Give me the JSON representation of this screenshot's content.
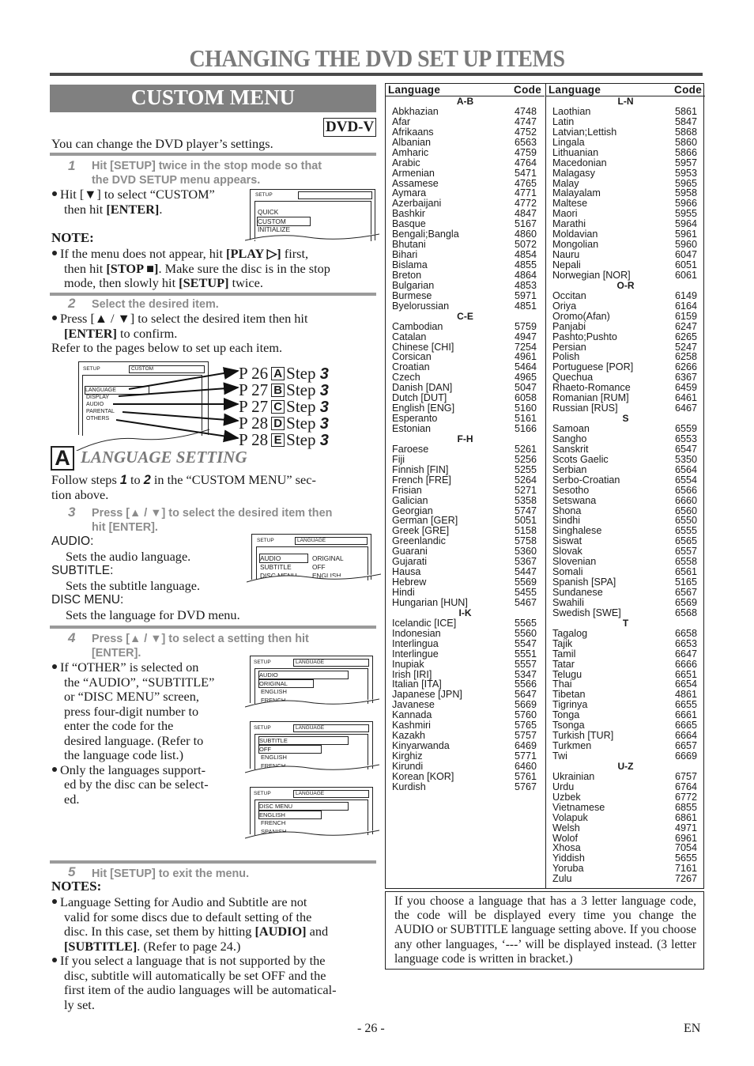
{
  "page_title": "CHANGING THE DVD SET UP ITEMS",
  "section_title": "CUSTOM MENU",
  "badge": "DVD-V",
  "intro": "You can change the DVD player’s settings.",
  "step1": {
    "num": "1",
    "line1": "Hit [SETUP] twice in the stop mode so that",
    "line2": "the DVD SETUP menu appears.",
    "bullet_line1": "Hit [▼] to select “CUSTOM”",
    "bullet_line2_pre": "then hit ",
    "bullet_line2_bold": "[ENTER]",
    "bullet_line2_post": ".",
    "screen": {
      "header": "SETUP",
      "items": [
        "QUICK",
        "CUSTOM",
        "INITIALIZE"
      ],
      "selected": "CUSTOM"
    }
  },
  "note": {
    "heading": "NOTE:",
    "line1_pre": "If the menu does not appear, hit ",
    "line1_bold": "[PLAY ▷]",
    "line1_post": " first,",
    "line2_pre": "then hit ",
    "line2_bold": "[STOP ■]",
    "line2_post": ". Make sure the disc is in the stop",
    "line3_pre": "mode, then slowly hit ",
    "line3_bold": "[SETUP]",
    "line3_post": " twice."
  },
  "step2": {
    "num": "2",
    "text": "Select the desired item.",
    "bullet_line1": "Press [▲ / ▼] to select the desired item then hit",
    "bullet_line2_bold": "[ENTER]",
    "bullet_line2_post": " to confirm.",
    "refer": "Refer to the pages below to set up each item.",
    "screen": {
      "header": "SETUP",
      "header_box": "CUSTOM",
      "items": [
        "LANGUAGE",
        "DISPLAY",
        "AUDIO",
        "PARENTAL",
        "OTHERS"
      ]
    },
    "refs": [
      {
        "page": "P 26",
        "letter": "A",
        "step_label": "Step",
        "step": "3"
      },
      {
        "page": "P 27",
        "letter": "B",
        "step_label": "Step",
        "step": "3"
      },
      {
        "page": "P 27",
        "letter": "C",
        "step_label": "Step",
        "step": "3"
      },
      {
        "page": "P 28",
        "letter": "D",
        "step_label": "Step",
        "step": "3"
      },
      {
        "page": "P 28",
        "letter": "E",
        "step_label": "Step",
        "step": "3"
      }
    ]
  },
  "lang_section": {
    "letter": "A",
    "title": "LANGUAGE SETTING",
    "follow_pre": "Follow steps ",
    "follow_s1": "1",
    "follow_mid": " to ",
    "follow_s2": "2",
    "follow_post": " in the “CUSTOM MENU” sec-",
    "follow_line2": "tion above.",
    "step3": {
      "num": "3",
      "line1": "Press [▲ / ▼] to select the desired item then",
      "line2": "hit [ENTER]."
    },
    "items": [
      {
        "label": "AUDIO:",
        "desc": "Sets the audio language."
      },
      {
        "label": "SUBTITLE:",
        "desc": "Sets the subtitle language."
      },
      {
        "label": "DISC MENU:",
        "desc": "Sets the language for DVD menu."
      }
    ],
    "screen": {
      "header": "SETUP",
      "header_box": "LANGUAGE",
      "rows": [
        {
          "k": "AUDIO",
          "v": "ORIGINAL"
        },
        {
          "k": "SUBTITLE",
          "v": "OFF"
        },
        {
          "k": "DISC MENU",
          "v": "ENGLISH"
        }
      ]
    },
    "step4": {
      "num": "4",
      "line1": "Press [▲ / ▼] to select a setting then hit",
      "line2": "[ENTER]."
    },
    "bullets": [
      [
        "If “OTHER” is selected on",
        "the “AUDIO”, “SUBTITLE”",
        "or “DISC MENU” screen,",
        "press four-digit number to",
        "enter the code for the",
        "desired language. (Refer to",
        "the language code list.)"
      ],
      [
        "Only the languages support-",
        "ed by the disc can be select-",
        "ed."
      ]
    ],
    "screens": [
      {
        "header": "SETUP",
        "header_box": "LANGUAGE",
        "title": "AUDIO",
        "items": [
          "ORIGINAL",
          "ENGLISH",
          "FRENCH"
        ]
      },
      {
        "header": "SETUP",
        "header_box": "LANGUAGE",
        "title": "SUBTITLE",
        "items": [
          "OFF",
          "ENGLISH",
          "FRENCH"
        ]
      },
      {
        "header": "SETUP",
        "header_box": "LANGUAGE",
        "title": "DISC MENU",
        "items": [
          "ENGLISH",
          "FRENCH",
          "SPANISH"
        ]
      }
    ],
    "step5": {
      "num": "5",
      "text": "Hit [SETUP] to exit the menu."
    },
    "notes_heading": "NOTES:",
    "notes": {
      "n1_l1": "Language Setting for Audio and Subtitle are not",
      "n1_l2": "valid for some discs due to default setting of the",
      "n1_l3_pre": "disc. In this case, set them by hitting ",
      "n1_l3_bold": "[AUDIO]",
      "n1_l3_post": " and",
      "n1_l4_bold": "[SUBTITLE]",
      "n1_l4_post": ". (Refer to page 24.)",
      "n2_l1": "If you select a language that is not supported by the",
      "n2_l2": "disc, subtitle will automatically be set OFF and the",
      "n2_l3": "first item of the audio languages will be automatical-",
      "n2_l4": "ly set."
    }
  },
  "table": {
    "header_language": "Language",
    "header_code": "Code",
    "left": [
      {
        "group": "A-B"
      },
      {
        "name": "Abkhazian",
        "code": "4748"
      },
      {
        "name": "Afar",
        "code": "4747"
      },
      {
        "name": "Afrikaans",
        "code": "4752"
      },
      {
        "name": "Albanian",
        "code": "6563"
      },
      {
        "name": "Amharic",
        "code": "4759"
      },
      {
        "name": "Arabic",
        "code": "4764"
      },
      {
        "name": "Armenian",
        "code": "5471"
      },
      {
        "name": "Assamese",
        "code": "4765"
      },
      {
        "name": "Aymara",
        "code": "4771"
      },
      {
        "name": "Azerbaijani",
        "code": "4772"
      },
      {
        "name": "Bashkir",
        "code": "4847"
      },
      {
        "name": "Basque",
        "code": "5167"
      },
      {
        "name": "Bengali;Bangla",
        "code": "4860"
      },
      {
        "name": "Bhutani",
        "code": "5072"
      },
      {
        "name": "Bihari",
        "code": "4854"
      },
      {
        "name": "Bislama",
        "code": "4855"
      },
      {
        "name": "Breton",
        "code": "4864"
      },
      {
        "name": "Bulgarian",
        "code": "4853"
      },
      {
        "name": "Burmese",
        "code": "5971"
      },
      {
        "name": "Byelorussian",
        "code": "4851"
      },
      {
        "group": "C-E"
      },
      {
        "name": "Cambodian",
        "code": "5759"
      },
      {
        "name": "Catalan",
        "code": "4947"
      },
      {
        "name": "Chinese [CHI]",
        "code": "7254"
      },
      {
        "name": "Corsican",
        "code": "4961"
      },
      {
        "name": "Croatian",
        "code": "5464"
      },
      {
        "name": "Czech",
        "code": "4965"
      },
      {
        "name": "Danish [DAN]",
        "code": "5047"
      },
      {
        "name": "Dutch [DUT]",
        "code": "6058"
      },
      {
        "name": "English [ENG]",
        "code": "5160"
      },
      {
        "name": "Esperanto",
        "code": "5161"
      },
      {
        "name": "Estonian",
        "code": "5166"
      },
      {
        "group": "F-H"
      },
      {
        "name": "Faroese",
        "code": "5261"
      },
      {
        "name": "Fiji",
        "code": "5256"
      },
      {
        "name": "Finnish [FIN]",
        "code": "5255"
      },
      {
        "name": "French [FRE]",
        "code": "5264"
      },
      {
        "name": "Frisian",
        "code": "5271"
      },
      {
        "name": "Galician",
        "code": "5358"
      },
      {
        "name": "Georgian",
        "code": "5747"
      },
      {
        "name": "German [GER]",
        "code": "5051"
      },
      {
        "name": "Greek [GRE]",
        "code": "5158"
      },
      {
        "name": "Greenlandic",
        "code": "5758"
      },
      {
        "name": "Guarani",
        "code": "5360"
      },
      {
        "name": "Gujarati",
        "code": "5367"
      },
      {
        "name": "Hausa",
        "code": "5447"
      },
      {
        "name": "Hebrew",
        "code": "5569"
      },
      {
        "name": "Hindi",
        "code": "5455"
      },
      {
        "name": "Hungarian [HUN]",
        "code": "5467"
      },
      {
        "group": "I-K"
      },
      {
        "name": "Icelandic [ICE]",
        "code": "5565"
      },
      {
        "name": "Indonesian",
        "code": "5560"
      },
      {
        "name": "Interlingua",
        "code": "5547"
      },
      {
        "name": "Interlingue",
        "code": "5551"
      },
      {
        "name": "Inupiak",
        "code": "5557"
      },
      {
        "name": "Irish [IRI]",
        "code": "5347"
      },
      {
        "name": "Italian [ITA]",
        "code": "5566"
      },
      {
        "name": "Japanese [JPN]",
        "code": "5647"
      },
      {
        "name": "Javanese",
        "code": "5669"
      },
      {
        "name": "Kannada",
        "code": "5760"
      },
      {
        "name": "Kashmiri",
        "code": "5765"
      },
      {
        "name": "Kazakh",
        "code": "5757"
      },
      {
        "name": "Kinyarwanda",
        "code": "6469"
      },
      {
        "name": "Kirghiz",
        "code": "5771"
      },
      {
        "name": "Kirundi",
        "code": "6460"
      },
      {
        "name": "Korean [KOR]",
        "code": "5761"
      },
      {
        "name": "Kurdish",
        "code": "5767"
      }
    ],
    "right": [
      {
        "group": "L-N"
      },
      {
        "name": "Laothian",
        "code": "5861"
      },
      {
        "name": "Latin",
        "code": "5847"
      },
      {
        "name": "Latvian;Lettish",
        "code": "5868"
      },
      {
        "name": "Lingala",
        "code": "5860"
      },
      {
        "name": "Lithuanian",
        "code": "5866"
      },
      {
        "name": "Macedonian",
        "code": "5957"
      },
      {
        "name": "Malagasy",
        "code": "5953"
      },
      {
        "name": "Malay",
        "code": "5965"
      },
      {
        "name": "Malayalam",
        "code": "5958"
      },
      {
        "name": "Maltese",
        "code": "5966"
      },
      {
        "name": "Maori",
        "code": "5955"
      },
      {
        "name": "Marathi",
        "code": "5964"
      },
      {
        "name": "Moldavian",
        "code": "5961"
      },
      {
        "name": "Mongolian",
        "code": "5960"
      },
      {
        "name": "Nauru",
        "code": "6047"
      },
      {
        "name": "Nepali",
        "code": "6051"
      },
      {
        "name": "Norwegian [NOR]",
        "code": "6061"
      },
      {
        "group": "O-R"
      },
      {
        "name": "Occitan",
        "code": "6149"
      },
      {
        "name": "Oriya",
        "code": "6164"
      },
      {
        "name": "Oromo(Afan)",
        "code": "6159"
      },
      {
        "name": "Panjabi",
        "code": "6247"
      },
      {
        "name": "Pashto;Pushto",
        "code": "6265"
      },
      {
        "name": "Persian",
        "code": "5247"
      },
      {
        "name": "Polish",
        "code": "6258"
      },
      {
        "name": "Portuguese [POR]",
        "code": "6266"
      },
      {
        "name": "Quechua",
        "code": "6367"
      },
      {
        "name": "Rhaeto-Romance",
        "code": "6459"
      },
      {
        "name": "Romanian [RUM]",
        "code": "6461"
      },
      {
        "name": "Russian [RUS]",
        "code": "6467"
      },
      {
        "group": "S"
      },
      {
        "name": "Samoan",
        "code": "6559"
      },
      {
        "name": "Sangho",
        "code": "6553"
      },
      {
        "name": "Sanskrit",
        "code": "6547"
      },
      {
        "name": "Scots Gaelic",
        "code": "5350"
      },
      {
        "name": "Serbian",
        "code": "6564"
      },
      {
        "name": "Serbo-Croatian",
        "code": "6554"
      },
      {
        "name": "Sesotho",
        "code": "6566"
      },
      {
        "name": "Setswana",
        "code": "6660"
      },
      {
        "name": "Shona",
        "code": "6560"
      },
      {
        "name": "Sindhi",
        "code": "6550"
      },
      {
        "name": "Singhalese",
        "code": "6555"
      },
      {
        "name": "Siswat",
        "code": "6565"
      },
      {
        "name": "Slovak",
        "code": "6557"
      },
      {
        "name": "Slovenian",
        "code": "6558"
      },
      {
        "name": "Somali",
        "code": "6561"
      },
      {
        "name": "Spanish [SPA]",
        "code": "5165"
      },
      {
        "name": "Sundanese",
        "code": "6567"
      },
      {
        "name": "Swahili",
        "code": "6569"
      },
      {
        "name": "Swedish [SWE]",
        "code": "6568"
      },
      {
        "group": "T"
      },
      {
        "name": "Tagalog",
        "code": "6658"
      },
      {
        "name": "Tajik",
        "code": "6653"
      },
      {
        "name": "Tamil",
        "code": "6647"
      },
      {
        "name": "Tatar",
        "code": "6666"
      },
      {
        "name": "Telugu",
        "code": "6651"
      },
      {
        "name": "Thai",
        "code": "6654"
      },
      {
        "name": "Tibetan",
        "code": "4861"
      },
      {
        "name": "Tigrinya",
        "code": "6655"
      },
      {
        "name": "Tonga",
        "code": "6661"
      },
      {
        "name": "Tsonga",
        "code": "6665"
      },
      {
        "name": "Turkish [TUR]",
        "code": "6664"
      },
      {
        "name": "Turkmen",
        "code": "6657"
      },
      {
        "name": "Twi",
        "code": "6669"
      },
      {
        "group": "U-Z"
      },
      {
        "name": "Ukrainian",
        "code": "6757"
      },
      {
        "name": "Urdu",
        "code": "6764"
      },
      {
        "name": "Uzbek",
        "code": "6772"
      },
      {
        "name": "Vietnamese",
        "code": "6855"
      },
      {
        "name": "Volapuk",
        "code": "6861"
      },
      {
        "name": "Welsh",
        "code": "4971"
      },
      {
        "name": "Wolof",
        "code": "6961"
      },
      {
        "name": "Xhosa",
        "code": "7054"
      },
      {
        "name": "Yiddish",
        "code": "5655"
      },
      {
        "name": "Yoruba",
        "code": "7161"
      },
      {
        "name": "Zulu",
        "code": "7267"
      }
    ]
  },
  "table_note": "If you choose a language that has a 3 letter language code, the code will be displayed every time you change the AUDIO or SUBTITLE language setting above. If you choose any other languages, ‘---’ will be displayed instead. (3 letter language code is written in bracket.)",
  "footer": {
    "page": "- 26 -",
    "lang": "EN"
  }
}
